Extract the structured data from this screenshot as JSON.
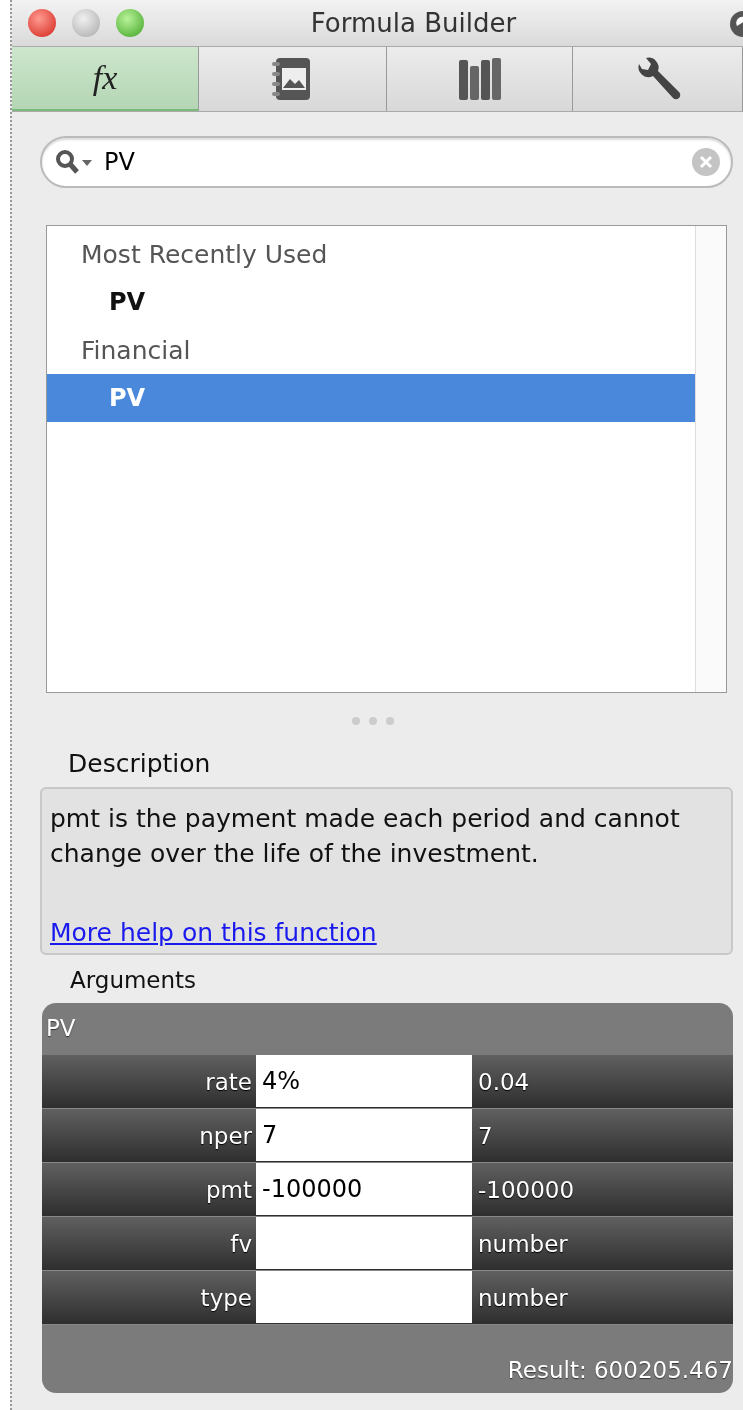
{
  "window": {
    "title": "Formula Builder"
  },
  "tabs": [
    {
      "kind": "fx",
      "label": "fx",
      "selected": true
    },
    {
      "kind": "media",
      "selected": false
    },
    {
      "kind": "books",
      "selected": false
    },
    {
      "kind": "tools",
      "selected": false
    }
  ],
  "search": {
    "value": "PV"
  },
  "function_list": [
    {
      "label": "Most Recently Used",
      "items": [
        {
          "label": "PV",
          "selected": false
        }
      ]
    },
    {
      "label": "Financial",
      "items": [
        {
          "label": "PV",
          "selected": true
        }
      ]
    }
  ],
  "description": {
    "heading": "Description",
    "text": "pmt is the payment made each period and cannot change over the life of the investment.",
    "link": "More help on this function"
  },
  "arguments": {
    "heading": "Arguments",
    "function": "PV",
    "rows": [
      {
        "name": "rate",
        "value": "4%",
        "evaluated": "0.04"
      },
      {
        "name": "nper",
        "value": "7",
        "evaluated": "7"
      },
      {
        "name": "pmt",
        "value": "-100000",
        "evaluated": "-100000"
      },
      {
        "name": "fv",
        "value": "",
        "evaluated": "number"
      },
      {
        "name": "type",
        "value": "",
        "evaluated": "number"
      }
    ],
    "result": "Result: 600205.467"
  }
}
